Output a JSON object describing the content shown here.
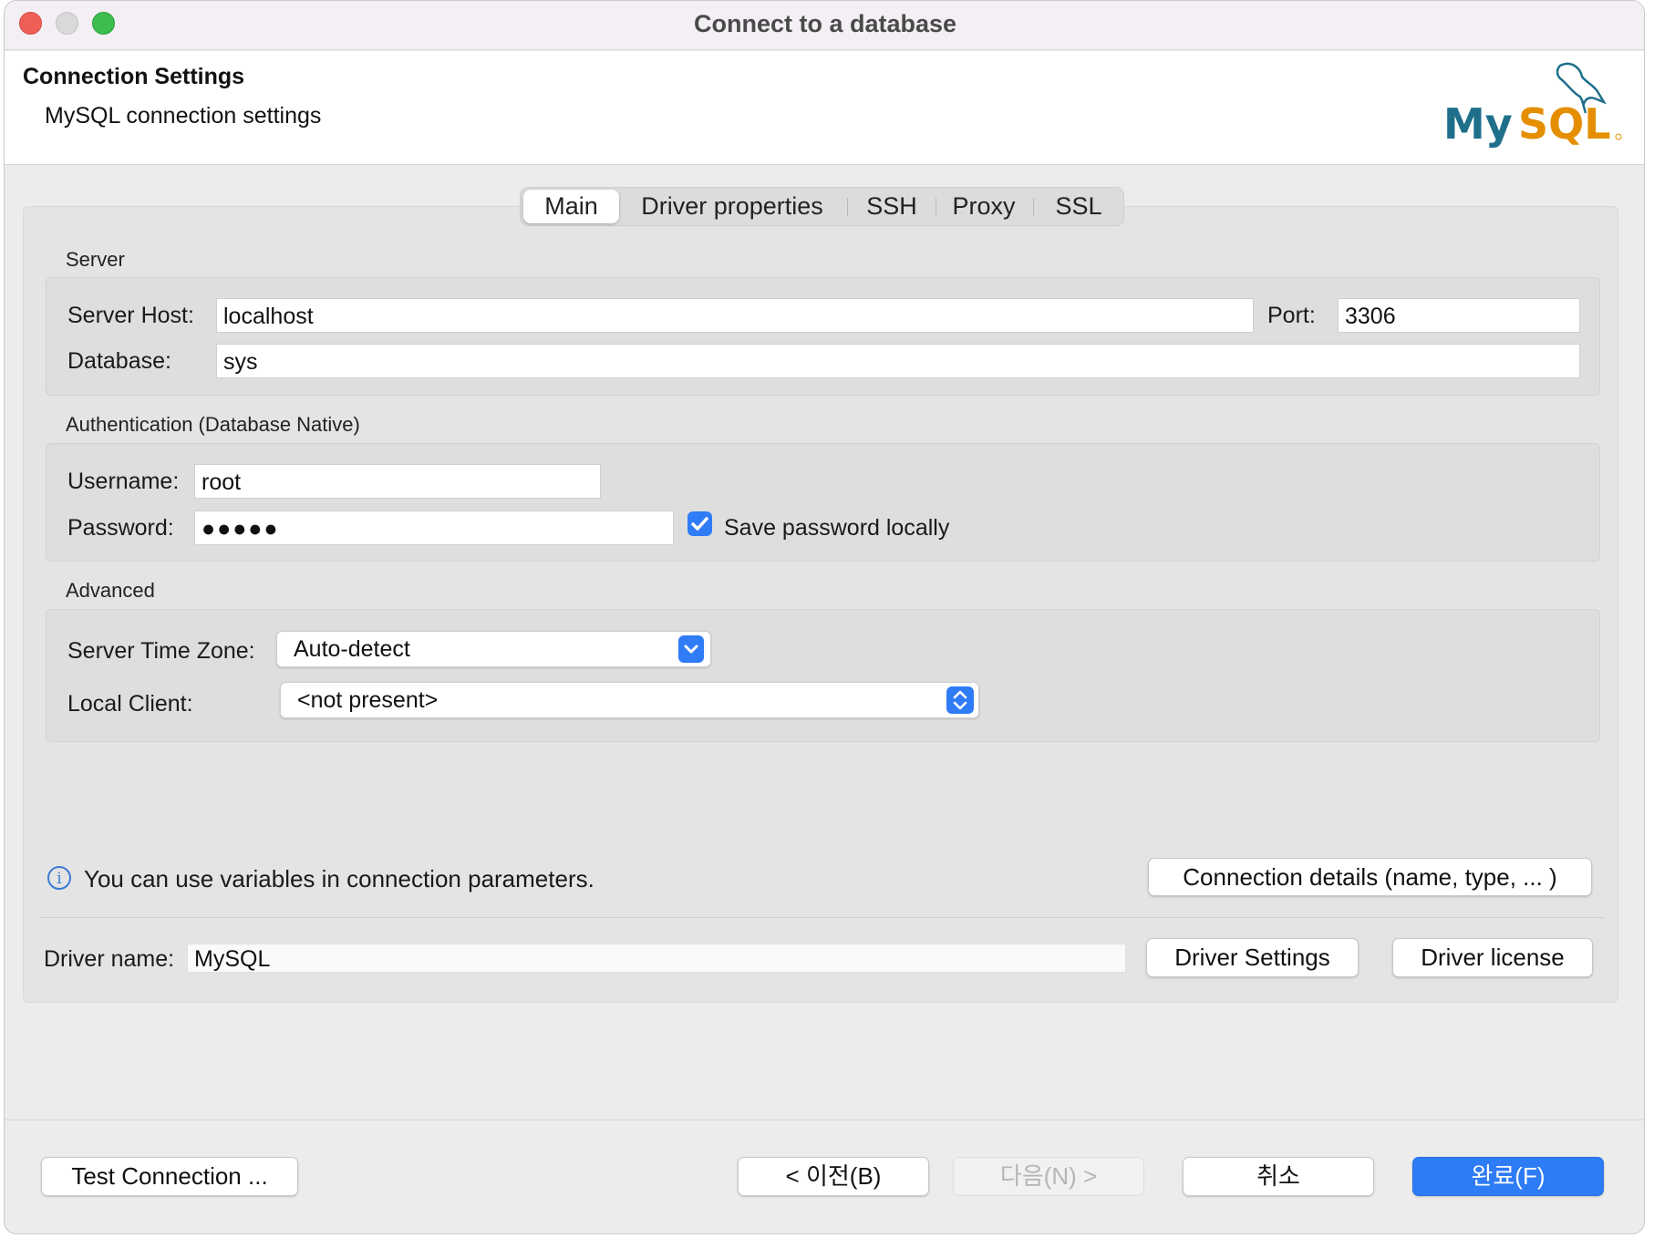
{
  "window": {
    "title": "Connect to a database"
  },
  "banner": {
    "title": "Connection Settings",
    "subtitle": "MySQL connection settings",
    "logo_text": "MySQL"
  },
  "tabs": [
    {
      "label": "Main",
      "selected": true
    },
    {
      "label": "Driver properties",
      "selected": false
    },
    {
      "label": "SSH",
      "selected": false
    },
    {
      "label": "Proxy",
      "selected": false
    },
    {
      "label": "SSL",
      "selected": false
    }
  ],
  "server": {
    "group_label": "Server",
    "host_label": "Server Host:",
    "host_value": "localhost",
    "port_label": "Port:",
    "port_value": "3306",
    "database_label": "Database:",
    "database_value": "sys"
  },
  "auth": {
    "group_label": "Authentication (Database Native)",
    "username_label": "Username:",
    "username_value": "root",
    "password_label": "Password:",
    "password_value": "●●●●●",
    "save_password_label": "Save password locally",
    "save_password_checked": true
  },
  "advanced": {
    "group_label": "Advanced",
    "timezone_label": "Server Time Zone:",
    "timezone_value": "Auto-detect",
    "local_client_label": "Local Client:",
    "local_client_value": "<not present>"
  },
  "info": {
    "text": "You can use variables in connection parameters.",
    "icon": "info-icon"
  },
  "connection_details_button": "Connection details (name, type, ... )",
  "driver": {
    "name_label": "Driver name:",
    "name_value": "MySQL",
    "settings_button": "Driver Settings",
    "license_button": "Driver license"
  },
  "footer": {
    "test_button": "Test Connection ...",
    "back_button": "< 이전(B)",
    "next_button": "다음(N) >",
    "cancel_button": "취소",
    "finish_button": "완료(F)"
  },
  "colors": {
    "accent": "#2e7bf6",
    "traffic_close": "#ee5f57",
    "traffic_min": "#d9d9d9",
    "traffic_max": "#3dbd4e",
    "mysql_blue": "#1f6f8b",
    "mysql_orange": "#e48e00"
  }
}
